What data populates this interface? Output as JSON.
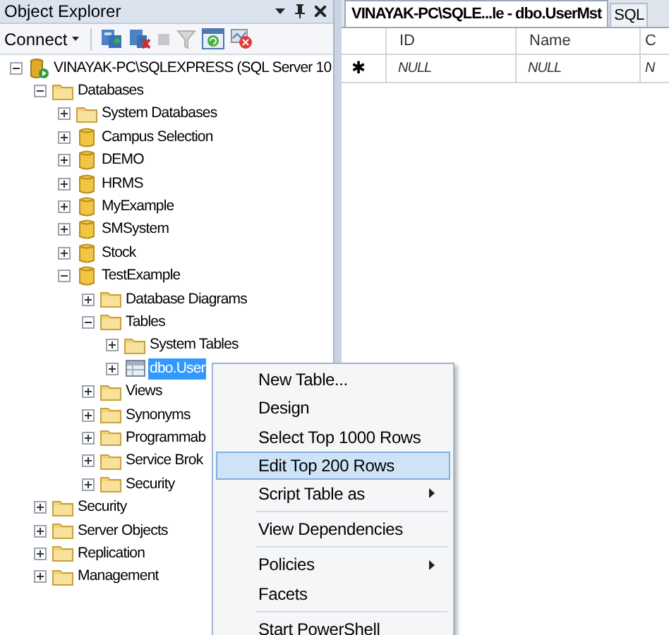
{
  "object_explorer": {
    "title": "Object Explorer",
    "toolbar": {
      "connect": "Connect"
    },
    "tree": [
      {
        "label": "VINAYAK-PC\\SQLEXPRESS (SQL Server 10",
        "kind": "server",
        "expanded": true,
        "selected": false,
        "children": [
          {
            "label": "Databases",
            "kind": "folder",
            "expanded": true,
            "selected": false,
            "children": [
              {
                "label": "System Databases",
                "kind": "folder",
                "expanded": false,
                "selected": false
              },
              {
                "label": "Campus Selection",
                "kind": "database",
                "expanded": false,
                "selected": false
              },
              {
                "label": "DEMO",
                "kind": "database",
                "expanded": false,
                "selected": false
              },
              {
                "label": "HRMS",
                "kind": "database",
                "expanded": false,
                "selected": false
              },
              {
                "label": "MyExample",
                "kind": "database",
                "expanded": false,
                "selected": false
              },
              {
                "label": "SMSystem",
                "kind": "database",
                "expanded": false,
                "selected": false
              },
              {
                "label": "Stock",
                "kind": "database",
                "expanded": false,
                "selected": false
              },
              {
                "label": "TestExample",
                "kind": "database",
                "expanded": true,
                "selected": false,
                "children": [
                  {
                    "label": "Database Diagrams",
                    "kind": "folder",
                    "expanded": false,
                    "selected": false
                  },
                  {
                    "label": "Tables",
                    "kind": "folder",
                    "expanded": true,
                    "selected": false,
                    "children": [
                      {
                        "label": "System Tables",
                        "kind": "folder",
                        "expanded": false,
                        "selected": false
                      },
                      {
                        "label": "dbo.User",
                        "kind": "table",
                        "expanded": false,
                        "selected": true
                      }
                    ]
                  },
                  {
                    "label": "Views",
                    "kind": "folder",
                    "expanded": false,
                    "selected": false
                  },
                  {
                    "label": "Synonyms",
                    "kind": "folder",
                    "expanded": false,
                    "selected": false
                  },
                  {
                    "label": "Programmab",
                    "kind": "folder",
                    "expanded": false,
                    "selected": false
                  },
                  {
                    "label": "Service Brok",
                    "kind": "folder",
                    "expanded": false,
                    "selected": false
                  },
                  {
                    "label": "Security",
                    "kind": "folder",
                    "expanded": false,
                    "selected": false
                  }
                ]
              }
            ]
          },
          {
            "label": "Security",
            "kind": "folder",
            "expanded": false,
            "selected": false
          },
          {
            "label": "Server Objects",
            "kind": "folder",
            "expanded": false,
            "selected": false
          },
          {
            "label": "Replication",
            "kind": "folder",
            "expanded": false,
            "selected": false
          },
          {
            "label": "Management",
            "kind": "folder",
            "expanded": false,
            "selected": false
          }
        ]
      }
    ]
  },
  "document_tabs": [
    {
      "label": "VINAYAK-PC\\SQLE...le - dbo.UserMst",
      "selected": true
    },
    {
      "label": "SQL",
      "selected": false
    }
  ],
  "grid": {
    "columns": [
      "ID",
      "Name",
      "C"
    ],
    "rows": [
      {
        "marker": "✱",
        "cells": [
          "NULL",
          "NULL",
          "N"
        ]
      }
    ]
  },
  "context_menu": {
    "items": [
      {
        "kind": "item",
        "label": "New Table...",
        "highlighted": false,
        "submenu": false
      },
      {
        "kind": "item",
        "label": "Design",
        "highlighted": false,
        "submenu": false
      },
      {
        "kind": "item",
        "label": "Select Top 1000 Rows",
        "highlighted": false,
        "submenu": false
      },
      {
        "kind": "item",
        "label": "Edit Top 200 Rows",
        "highlighted": true,
        "submenu": false
      },
      {
        "kind": "item",
        "label": "Script Table as",
        "highlighted": false,
        "submenu": true
      },
      {
        "kind": "separator"
      },
      {
        "kind": "item",
        "label": "View Dependencies",
        "highlighted": false,
        "submenu": false
      },
      {
        "kind": "separator"
      },
      {
        "kind": "item",
        "label": "Policies",
        "highlighted": false,
        "submenu": true
      },
      {
        "kind": "item",
        "label": "Facets",
        "highlighted": false,
        "submenu": false
      },
      {
        "kind": "separator"
      },
      {
        "kind": "item",
        "label": "Start PowerShell",
        "highlighted": false,
        "submenu": false
      }
    ]
  }
}
